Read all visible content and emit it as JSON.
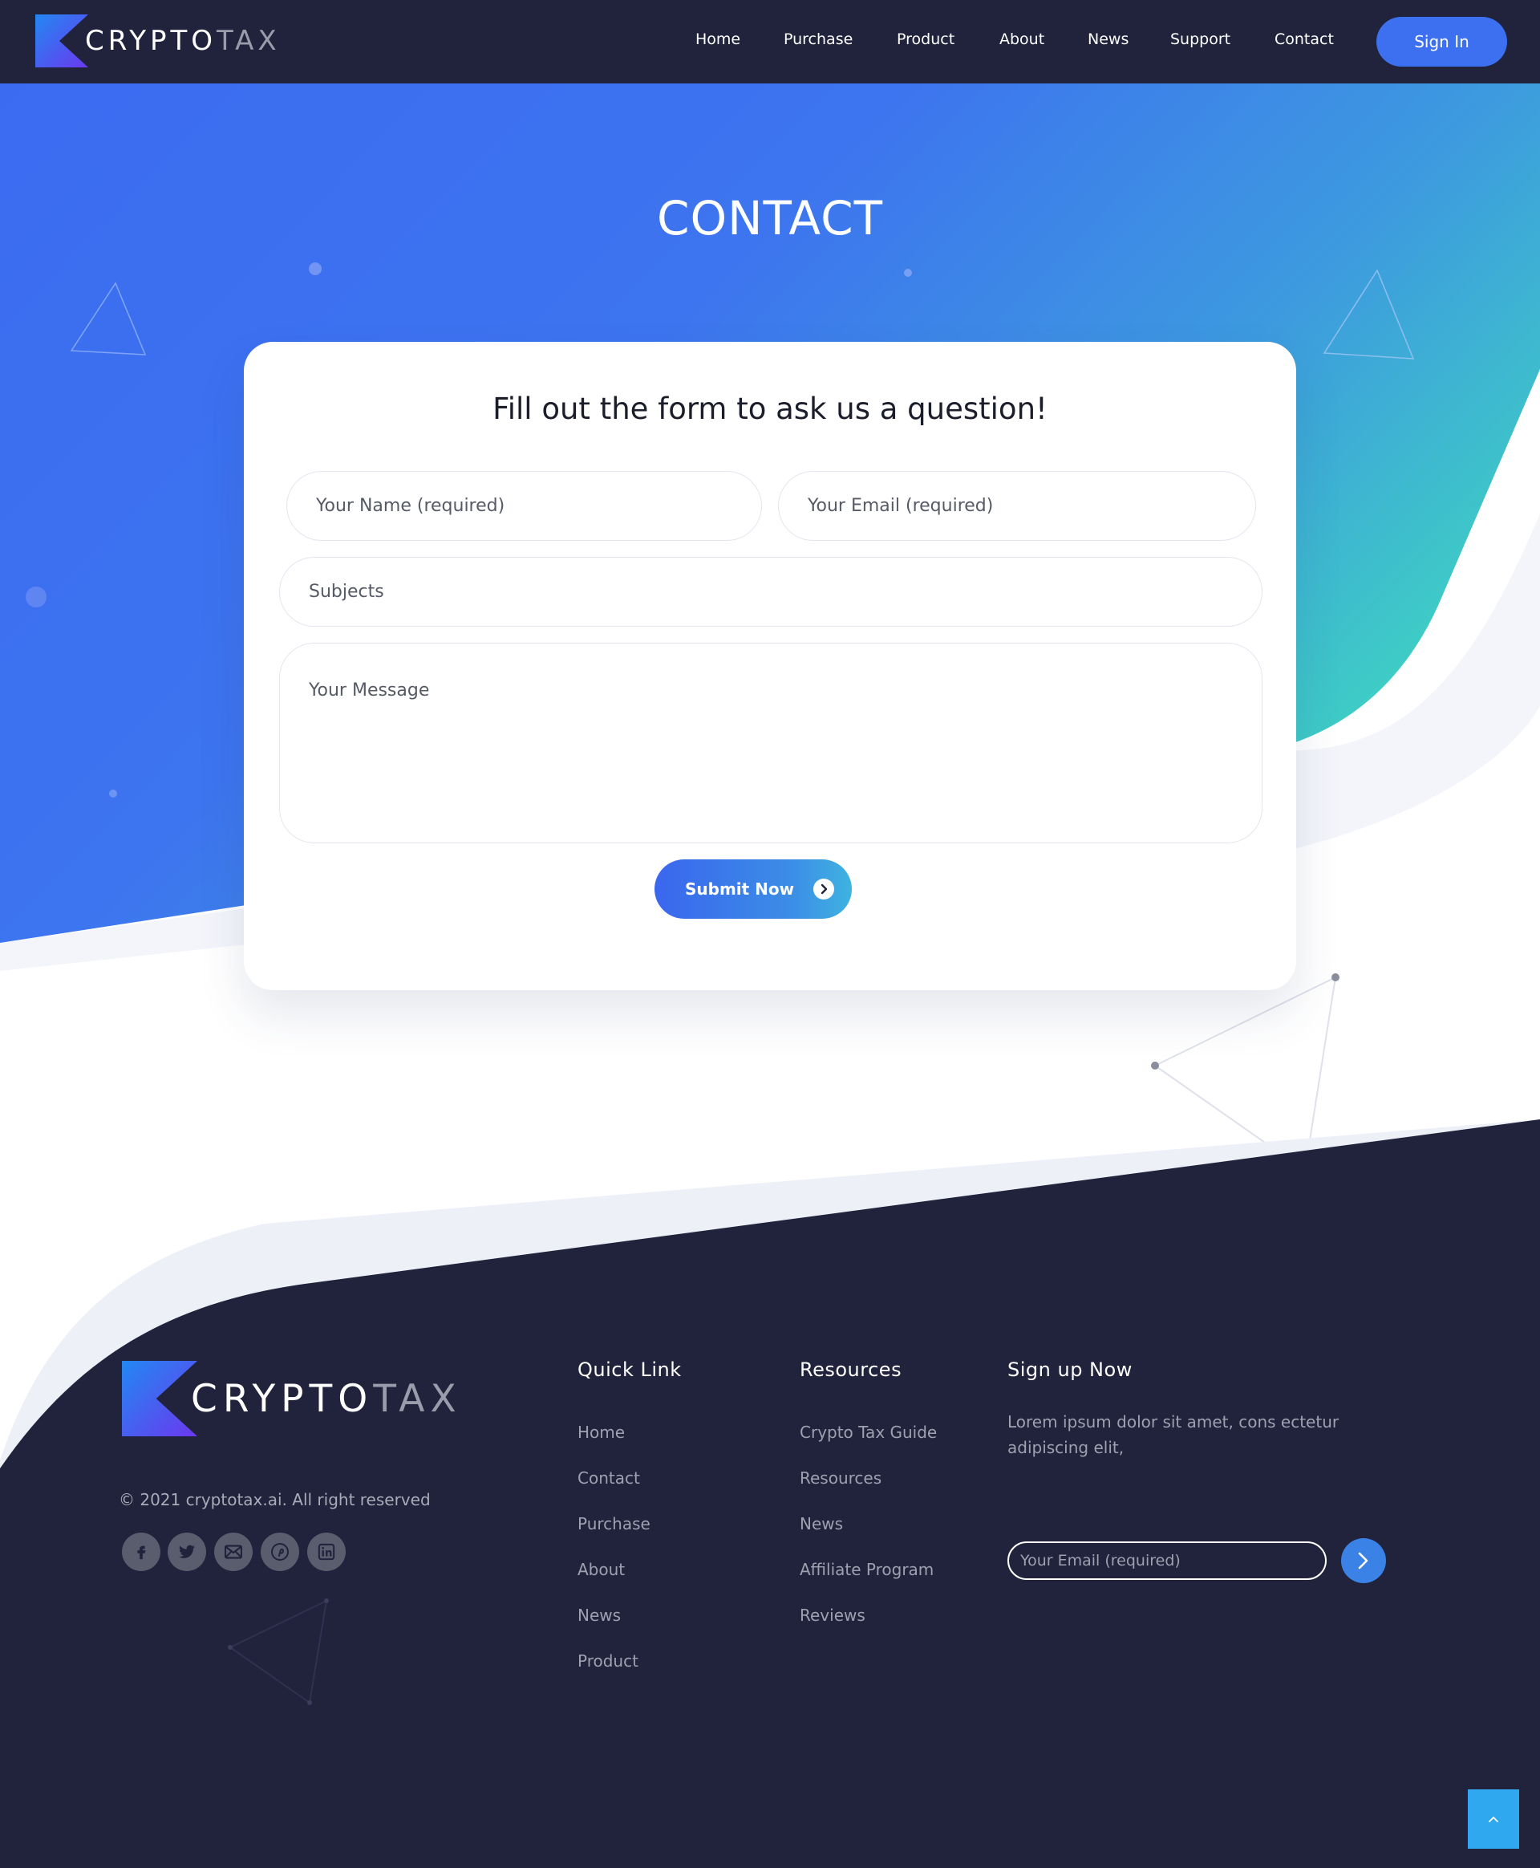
{
  "brand": {
    "name_part1": "CRYPTO",
    "name_part2": "TAX"
  },
  "nav": {
    "items": [
      {
        "label": "Home"
      },
      {
        "label": "Purchase"
      },
      {
        "label": "Product"
      },
      {
        "label": "About"
      },
      {
        "label": "News"
      },
      {
        "label": "Support"
      },
      {
        "label": "Contact"
      }
    ],
    "sign_in": "Sign In"
  },
  "hero": {
    "title": "CONTACT"
  },
  "form": {
    "heading": "Fill out the form to ask us a question!",
    "name_placeholder": "Your Name (required)",
    "email_placeholder": "Your Email (required)",
    "subject_placeholder": "Subjects",
    "message_placeholder": "Your Message",
    "submit_label": "Submit Now"
  },
  "footer": {
    "copyright": "© 2021 cryptotax.ai. All right reserved",
    "social_icons": [
      "facebook-icon",
      "twitter-icon",
      "mail-icon",
      "pinterest-icon",
      "linkedin-icon"
    ],
    "quick_link": {
      "title": "Quick Link",
      "links": [
        "Home",
        "Contact",
        "Purchase",
        "About",
        "News",
        "Product"
      ]
    },
    "resources": {
      "title": "Resources",
      "links": [
        "Crypto Tax Guide",
        "Resources",
        "News",
        "Affiliate Program",
        "Reviews"
      ]
    },
    "signup": {
      "title": "Sign up Now",
      "text": "Lorem ipsum dolor sit amet, cons ectetur adipiscing elit,",
      "email_placeholder": "Your Email (required)"
    }
  },
  "colors": {
    "header_bg": "#20233b",
    "hero_blue": "#3b6cf2",
    "hero_teal": "#3ecbc6",
    "accent_button": "#3c70f0",
    "footer_bg": "#20233b",
    "scroll_top": "#2fa8ef"
  }
}
